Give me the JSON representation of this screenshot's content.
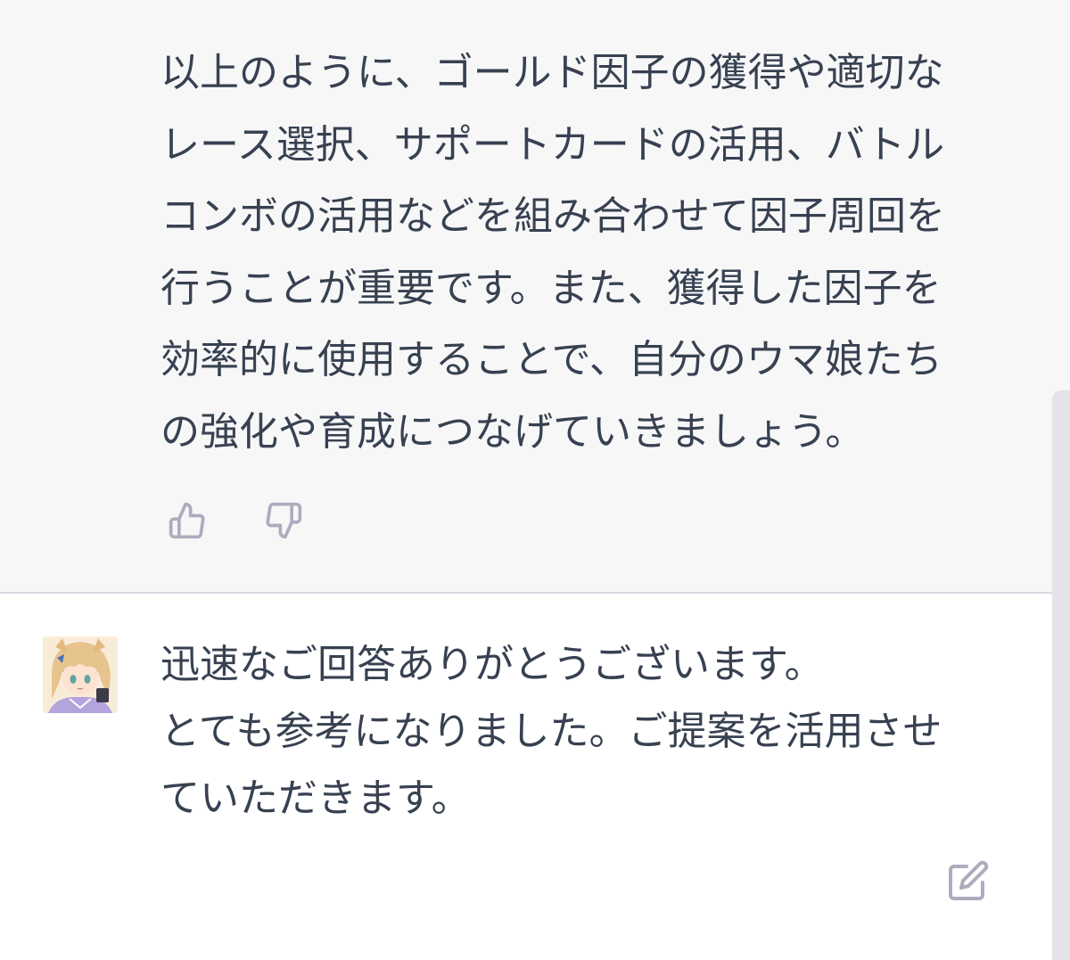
{
  "assistant_message": {
    "lines": [
      "以上のように、ゴールド因子の獲得や適切な",
      "レース選択、サポートカードの活用、バトル",
      "コンボの活用などを組み合わせて因子周回を",
      "行うことが重要です。また、獲得した因子を",
      "効率的に使用することで、自分のウマ娘たち",
      "の強化や育成につなげていきましょう。"
    ],
    "feedback": {
      "thumbs_up_icon": "thumbs-up-icon",
      "thumbs_down_icon": "thumbs-down-icon"
    }
  },
  "user_message": {
    "lines": [
      "迅速なご回答ありがとうございます。",
      "とても参考になりました。ご提案を活用させ",
      "ていただきます。"
    ],
    "edit_icon": "edit-icon"
  },
  "colors": {
    "assistant_bg": "#f7f7f8",
    "user_bg": "#ffffff",
    "text": "#374151",
    "icon": "#acacbe",
    "divider": "#d9d9e3",
    "scrollbar": "#e3e3e8"
  }
}
